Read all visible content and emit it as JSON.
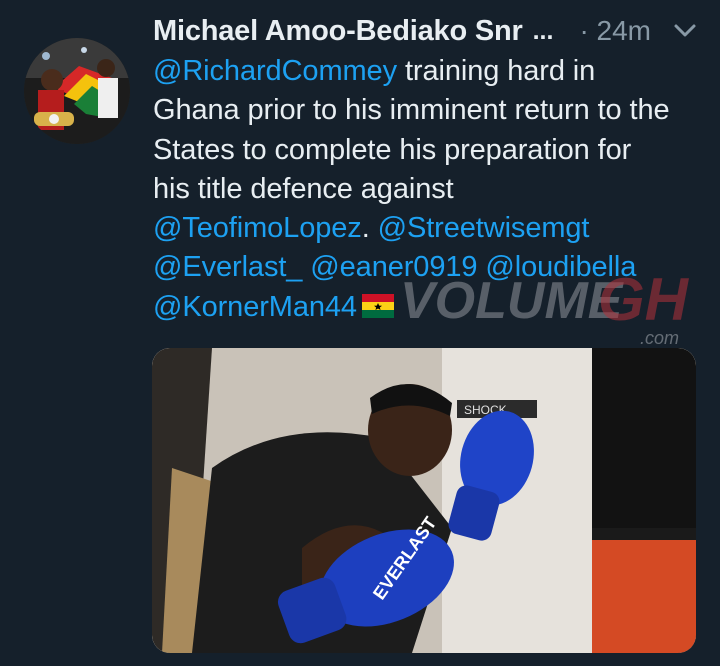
{
  "tweet": {
    "author_name": "Michael Amoo-Bediako Snr",
    "name_truncation": "...",
    "timestamp": "· 24m",
    "text": {
      "mention_1": "@RichardCommey",
      "line_1_rest": " training hard in",
      "line_2": "Ghana prior to his imminent return to the",
      "line_3": "States to complete his preparation for",
      "line_4": "his title defence against",
      "mention_2": "@TeofimoLopez",
      "separator": ". ",
      "mention_3": "@Streetwisemgt",
      "mention_4": "@Everlast_",
      "mention_5": "@eaner0919",
      "mention_6": "@loudibella",
      "mention_7": "@KornerMan44"
    },
    "flag_emoji": "ghana-flag-icon",
    "media": {
      "glove_brand": "EVERLAST",
      "bag_label": "SHOCK"
    }
  },
  "watermark": {
    "brand": "VOLUME",
    "suffix": "GH",
    "domain": ".com"
  },
  "colors": {
    "background": "#15202b",
    "text": "#e8eef2",
    "secondary_text": "#8899a6",
    "mention": "#1da1f2"
  }
}
